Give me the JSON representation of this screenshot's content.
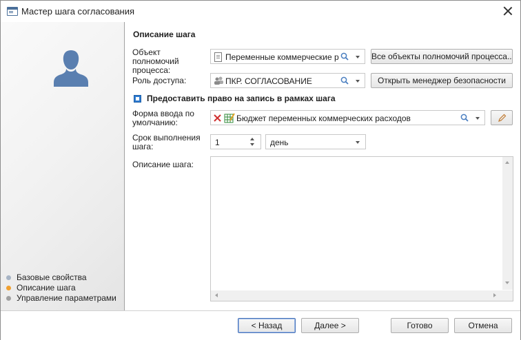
{
  "window": {
    "title": "Мастер шага согласования"
  },
  "sidebar": {
    "steps": [
      {
        "label": "Базовые свойства",
        "color": "#a7b4c5"
      },
      {
        "label": "Описание шага",
        "color": "#f0a030"
      },
      {
        "label": "Управление параметрами",
        "color": "#a0a0a0"
      }
    ]
  },
  "main": {
    "section_title": "Описание шага",
    "object": {
      "label": "Объект полномочий процесса:",
      "value": "Переменные коммерческие расх",
      "button": "Все объекты полномочий процесса..."
    },
    "role": {
      "label": "Роль доступа:",
      "value": "ПКР. СОГЛАСОВАНИЕ",
      "button": "Открыть менеджер безопасности"
    },
    "write_permission": {
      "label": "Предоставить право на запись в рамках шага",
      "checked": true
    },
    "form": {
      "label": "Форма ввода по умолчанию:",
      "value": "Бюджет переменных коммерческих расходов"
    },
    "duration": {
      "label": "Срок выполнения шага:",
      "value": "1",
      "unit": "день"
    },
    "description": {
      "label": "Описание шага:",
      "value": ""
    }
  },
  "footer": {
    "back": "< Назад",
    "next": "Далее >",
    "done": "Готово",
    "cancel": "Отмена"
  },
  "colors": {
    "accent": "#2f7bd0",
    "avatar": "#5a7fb0",
    "clear": "#d03030"
  }
}
